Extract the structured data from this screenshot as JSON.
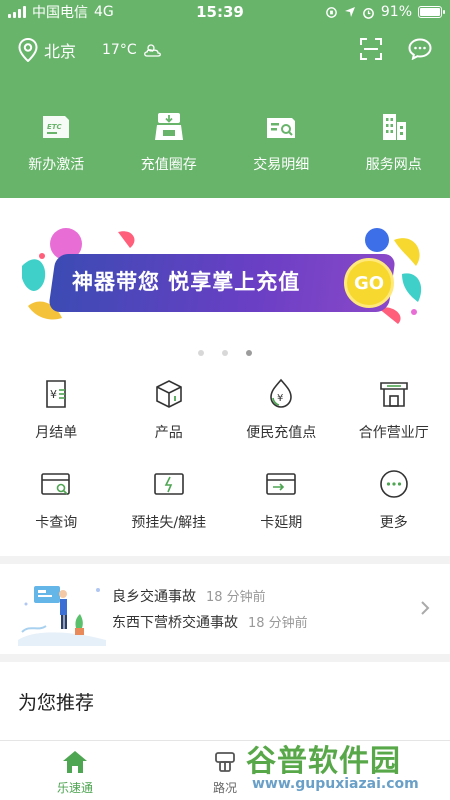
{
  "status_bar": {
    "carrier": "中国电信",
    "network": "4G",
    "time": "15:39",
    "battery": "91%",
    "battery_level": 0.91
  },
  "header": {
    "city": "北京",
    "temperature": "17°C",
    "weather_icon": "cloudy-icon"
  },
  "quick_actions": [
    {
      "label": "新办激活",
      "icon": "etc-card-icon"
    },
    {
      "label": "充值圈存",
      "icon": "card-reader-icon"
    },
    {
      "label": "交易明细",
      "icon": "transaction-icon"
    },
    {
      "label": "服务网点",
      "icon": "building-icon"
    }
  ],
  "banner": {
    "text": "神器带您 悦享掌上充值",
    "button": "GO",
    "active_slide": 3,
    "slides": 3
  },
  "services": [
    {
      "label": "月结单",
      "icon": "monthly-bill-icon"
    },
    {
      "label": "产品",
      "icon": "product-box-icon"
    },
    {
      "label": "便民充值点",
      "icon": "recharge-point-icon"
    },
    {
      "label": "合作营业厅",
      "icon": "store-icon"
    },
    {
      "label": "卡查询",
      "icon": "card-search-icon"
    },
    {
      "label": "预挂失/解挂",
      "icon": "card-lock-icon"
    },
    {
      "label": "卡延期",
      "icon": "card-extend-icon"
    },
    {
      "label": "更多",
      "icon": "more-icon"
    }
  ],
  "news": [
    {
      "title": "良乡交通事故",
      "time": "18 分钟前"
    },
    {
      "title": "东西下营桥交通事故",
      "time": "18 分钟前"
    }
  ],
  "recommend": {
    "title": "为您推荐"
  },
  "tabs": [
    {
      "label": "乐速通",
      "icon": "home-icon",
      "active": true
    },
    {
      "label": "路况",
      "icon": "road-icon",
      "active": false
    }
  ],
  "watermark": {
    "brand": "谷普软件园",
    "url": "www.gupuxiazai.com"
  },
  "colors": {
    "primary": "#68b46b",
    "accent": "#4ea552"
  }
}
